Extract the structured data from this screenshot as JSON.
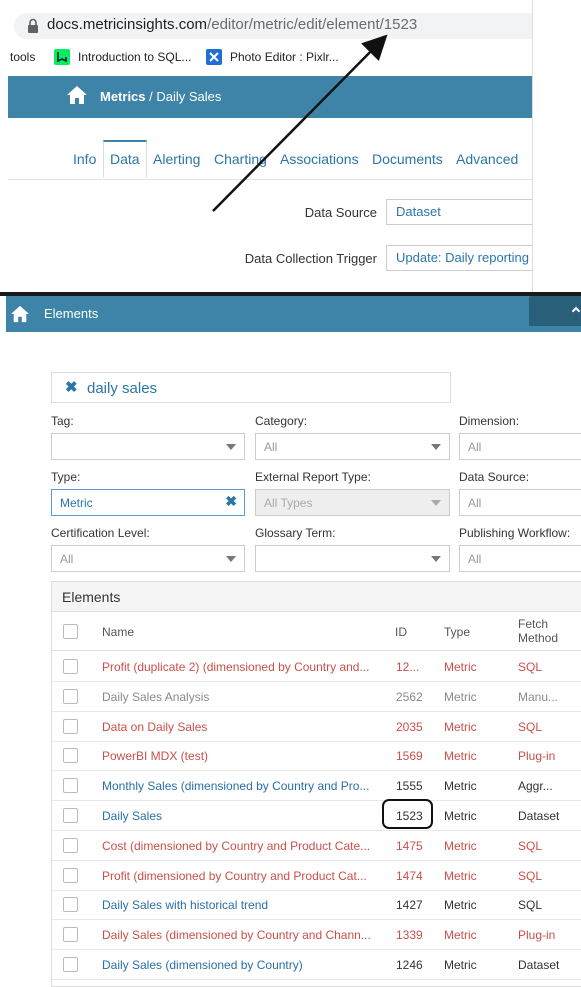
{
  "browser": {
    "url_host": "docs.metricinsights.com",
    "url_path": "/editor/metric/edit/element/1523",
    "bookmarks": [
      {
        "label": "tools",
        "icon": "none"
      },
      {
        "label": "Introduction to SQL...",
        "icon": "datacamp-icon",
        "color": "#03ef62"
      },
      {
        "label": "Photo Editor : Pixlr...",
        "icon": "pixlr-icon",
        "color": "#1f6fd1"
      }
    ]
  },
  "metric_editor": {
    "breadcrumb_root": "Metrics",
    "breadcrumb_sep": " / ",
    "breadcrumb_current": "Daily Sales",
    "tabs": [
      "Info",
      "Data",
      "Alerting",
      "Charting",
      "Associations",
      "Documents",
      "Advanced"
    ],
    "active_tab": "Data",
    "data_source_label": "Data Source",
    "data_source_value": "Dataset",
    "trigger_label": "Data Collection Trigger",
    "trigger_value": "Update: Daily reporting"
  },
  "elements_page": {
    "header_title": "Elements",
    "search_chip": "daily sales",
    "filters": {
      "tag_label": "Tag:",
      "tag_value": "",
      "category_label": "Category:",
      "category_value": "All",
      "dimension_label": "Dimension:",
      "dimension_value": "All",
      "type_label": "Type:",
      "type_value": "Metric",
      "external_report_type_label": "External Report Type:",
      "external_report_type_value": "All Types",
      "data_source_label": "Data Source:",
      "data_source_value": "All",
      "certification_label": "Certification Level:",
      "certification_value": "All",
      "glossary_label": "Glossary Term:",
      "glossary_value": "",
      "workflow_label": "Publishing Workflow:",
      "workflow_value": "All"
    },
    "table": {
      "title": "Elements",
      "columns": {
        "name": "Name",
        "id": "ID",
        "type": "Type",
        "fetch_1": "Fetch",
        "fetch_2": "Method"
      },
      "rows": [
        {
          "name": "Profit (duplicate 2) (dimensioned by Country and...",
          "id": "12...",
          "type": "Metric",
          "fetch": "SQL",
          "style": "red"
        },
        {
          "name": "Daily Sales Analysis",
          "id": "2562",
          "type": "Metric",
          "fetch": "Manu...",
          "style": "grey"
        },
        {
          "name": "Data on Daily Sales",
          "id": "2035",
          "type": "Metric",
          "fetch": "SQL",
          "style": "red"
        },
        {
          "name": "PowerBI MDX (test)",
          "id": "1569",
          "type": "Metric",
          "fetch": "Plug-in",
          "style": "red"
        },
        {
          "name": "Monthly Sales (dimensioned by Country and Pro...",
          "id": "1555",
          "type": "Metric",
          "fetch": "Aggr...",
          "style": "blue"
        },
        {
          "name": "Daily Sales",
          "id": "1523",
          "type": "Metric",
          "fetch": "Dataset",
          "style": "blue"
        },
        {
          "name": "Cost (dimensioned by Country and Product Cate...",
          "id": "1475",
          "type": "Metric",
          "fetch": "SQL",
          "style": "red"
        },
        {
          "name": "Profit (dimensioned by Country and Product Cat...",
          "id": "1474",
          "type": "Metric",
          "fetch": "SQL",
          "style": "red"
        },
        {
          "name": "Daily Sales with historical trend",
          "id": "1427",
          "type": "Metric",
          "fetch": "SQL",
          "style": "blue"
        },
        {
          "name": "Daily Sales (dimensioned by Country and Chann...",
          "id": "1339",
          "type": "Metric",
          "fetch": "Plug-in",
          "style": "red"
        },
        {
          "name": "Daily Sales (dimensioned by Country)",
          "id": "1246",
          "type": "Metric",
          "fetch": "Dataset",
          "style": "blue"
        }
      ]
    }
  },
  "annotation": {
    "highlighted_id": "1523",
    "arrow_target": "url element id"
  },
  "colors": {
    "header_blue": "#3d84a8",
    "link_blue": "#2a76a8",
    "red_link": "#c9504a"
  }
}
